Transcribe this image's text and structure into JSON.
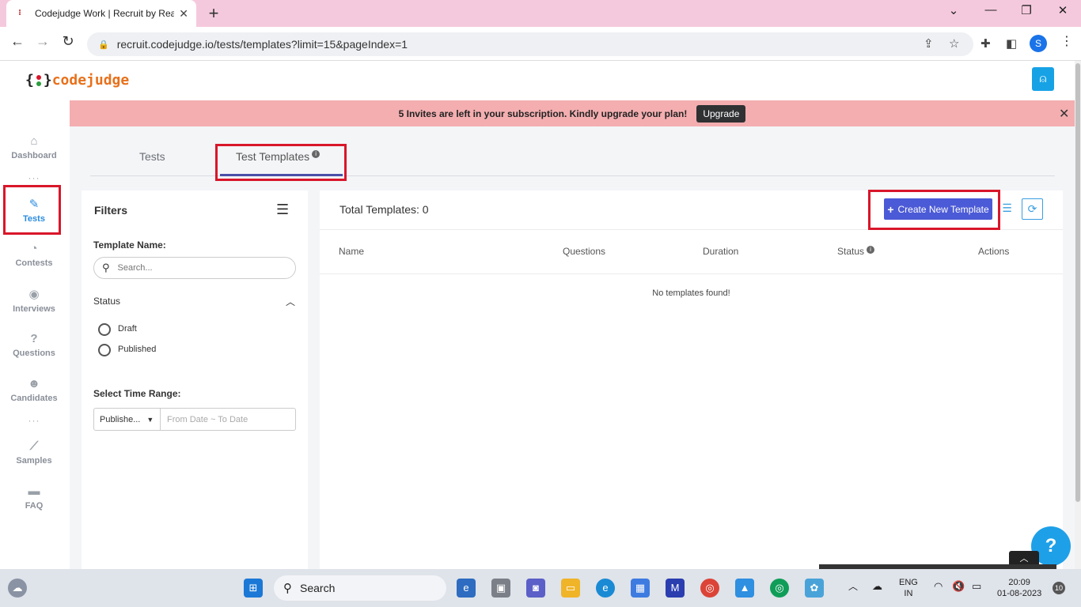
{
  "browser": {
    "tab_title": "Codejudge Work | Recruit by Rea",
    "url": "recruit.codejudge.io/tests/templates?limit=15&pageIndex=1",
    "profile_initial": "S"
  },
  "app": {
    "logo_word": "codejudge",
    "brand_color": "#e8701a"
  },
  "sidebar": {
    "items": [
      {
        "label": "Dashboard",
        "icon": "home-icon"
      },
      {
        "label": "Tests",
        "icon": "pencil-icon"
      },
      {
        "label": "Contests",
        "icon": "pie-chart-icon"
      },
      {
        "label": "Interviews",
        "icon": "podcast-icon"
      },
      {
        "label": "Questions",
        "icon": "question-circle-icon"
      },
      {
        "label": "Candidates",
        "icon": "users-icon"
      },
      {
        "label": "Samples",
        "icon": "line-chart-icon"
      },
      {
        "label": "FAQ",
        "icon": "comments-icon"
      }
    ]
  },
  "banner": {
    "message": "5 Invites are left in your subscription. Kindly upgrade your plan!",
    "button": "Upgrade"
  },
  "tabs": {
    "tests": "Tests",
    "templates": "Test Templates"
  },
  "filters": {
    "title": "Filters",
    "template_name_label": "Template Name:",
    "search_placeholder": "Search...",
    "status_label": "Status",
    "status_options": [
      "Draft",
      "Published"
    ],
    "time_range_label": "Select Time Range:",
    "time_range_type": "Publishe...",
    "date_placeholder": "From Date ~ To Date"
  },
  "templates": {
    "total": "Total Templates: 0",
    "create_button": "Create New Template",
    "columns": [
      "Name",
      "Questions",
      "Duration",
      "Status",
      "Actions"
    ],
    "empty_message": "No templates found!"
  },
  "taskbar": {
    "search": "Search",
    "lang_top": "ENG",
    "lang_bottom": "IN",
    "time": "20:09",
    "date": "01-08-2023",
    "notifications": "10"
  }
}
